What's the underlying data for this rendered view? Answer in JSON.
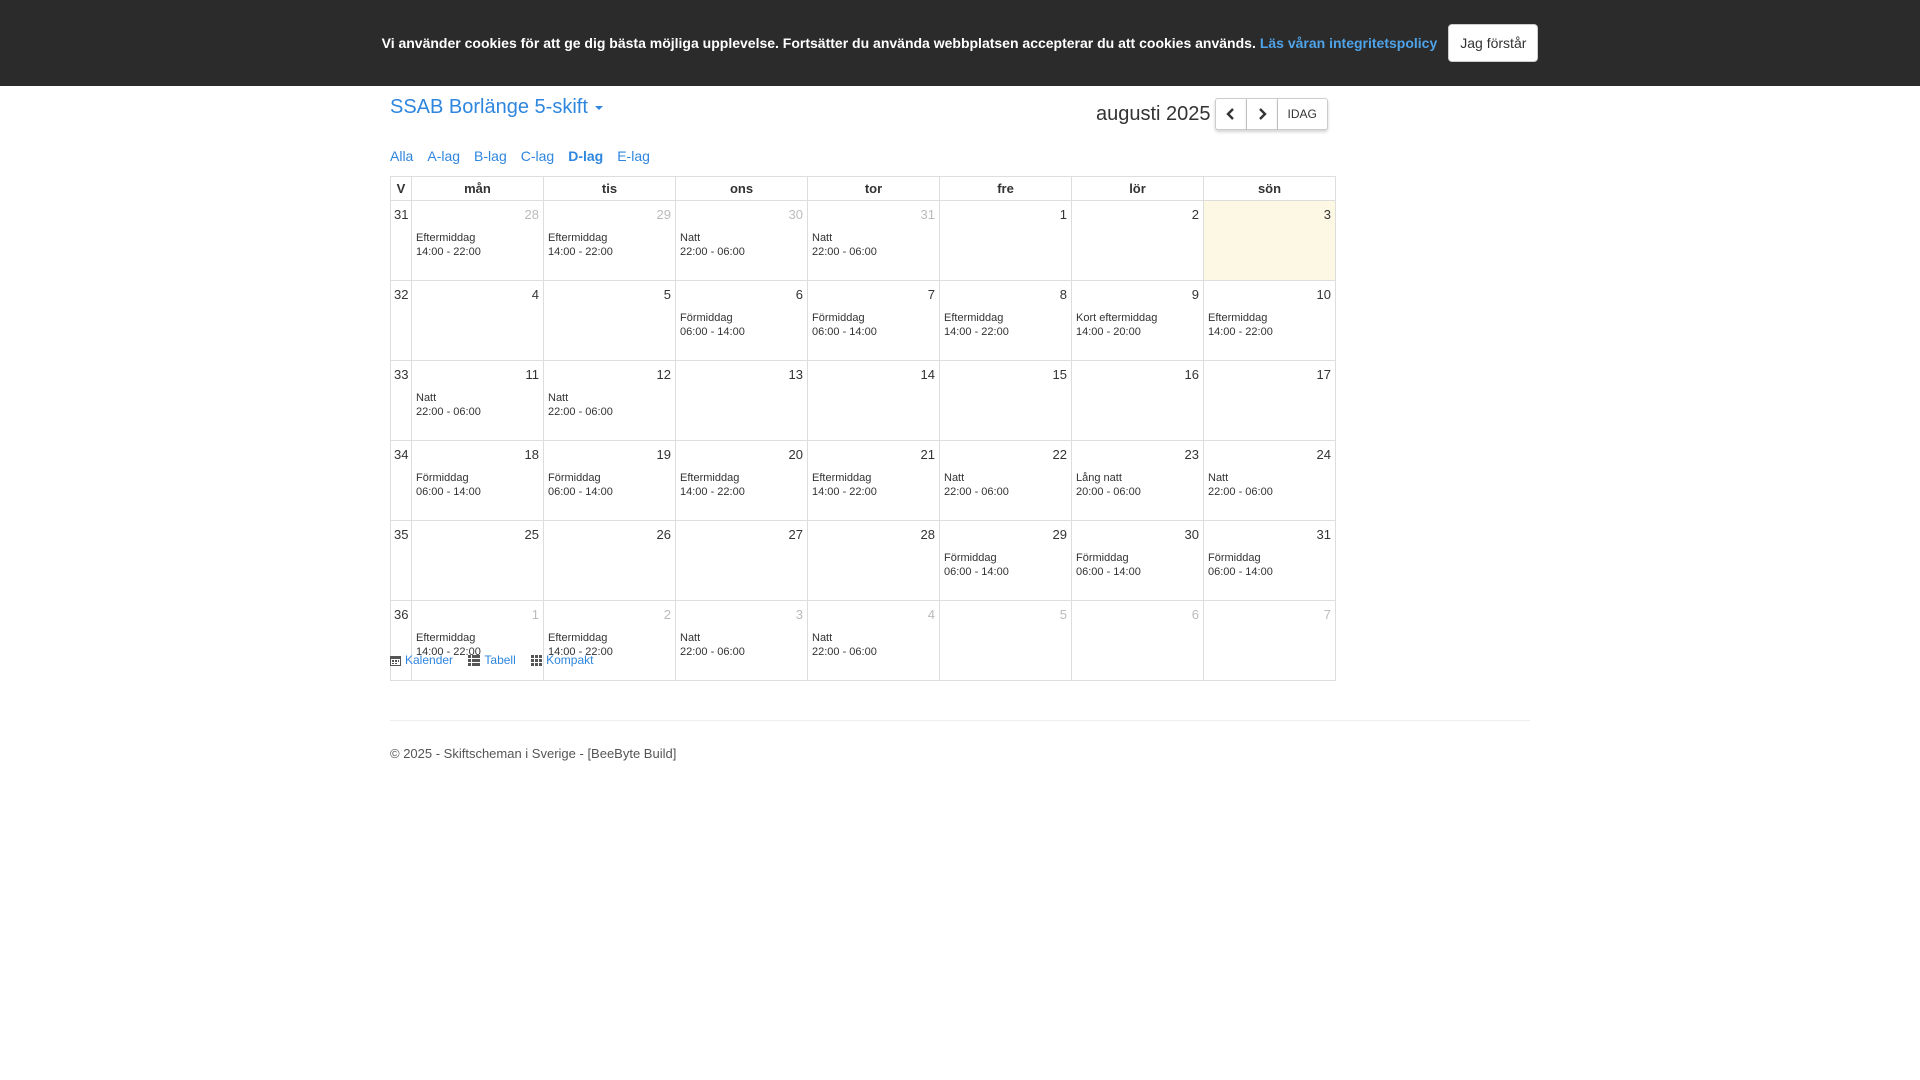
{
  "cookie": {
    "message": "Vi använder cookies för att ge dig bästa möjliga upplevelse. Fortsätter du använda webbplatsen accepterar du att cookies används.",
    "link": "Läs våran integritetspolicy",
    "button": "Jag förstår"
  },
  "header": {
    "title": "SSAB Borlänge 5-skift",
    "month": "augusti 2025",
    "today_label": "IDAG"
  },
  "teams": [
    "Alla",
    "A-lag",
    "B-lag",
    "C-lag",
    "D-lag",
    "E-lag"
  ],
  "calendar": {
    "week_header": "V",
    "days": [
      "mån",
      "tis",
      "ons",
      "tor",
      "fre",
      "lör",
      "sön"
    ],
    "weeks": [
      {
        "w": "31",
        "cells": [
          {
            "d": "28",
            "o": true,
            "n": "Eftermiddag",
            "t": "14:00 - 22:00"
          },
          {
            "d": "29",
            "o": true,
            "n": "Eftermiddag",
            "t": "14:00 - 22:00"
          },
          {
            "d": "30",
            "o": true,
            "n": "Natt",
            "t": "22:00 - 06:00"
          },
          {
            "d": "31",
            "o": true,
            "n": "Natt",
            "t": "22:00 - 06:00"
          },
          {
            "d": "1",
            "o": false,
            "n": "",
            "t": ""
          },
          {
            "d": "2",
            "o": false,
            "n": "",
            "t": ""
          },
          {
            "d": "3",
            "o": false,
            "n": "",
            "t": "",
            "today": true
          }
        ]
      },
      {
        "w": "32",
        "cells": [
          {
            "d": "4",
            "o": false,
            "n": "",
            "t": ""
          },
          {
            "d": "5",
            "o": false,
            "n": "",
            "t": ""
          },
          {
            "d": "6",
            "o": false,
            "n": "Förmiddag",
            "t": "06:00 - 14:00"
          },
          {
            "d": "7",
            "o": false,
            "n": "Förmiddag",
            "t": "06:00 - 14:00"
          },
          {
            "d": "8",
            "o": false,
            "n": "Eftermiddag",
            "t": "14:00 - 22:00"
          },
          {
            "d": "9",
            "o": false,
            "n": "Kort eftermiddag",
            "t": "14:00 - 20:00"
          },
          {
            "d": "10",
            "o": false,
            "n": "Eftermiddag",
            "t": "14:00 - 22:00"
          }
        ]
      },
      {
        "w": "33",
        "cells": [
          {
            "d": "11",
            "o": false,
            "n": "Natt",
            "t": "22:00 - 06:00"
          },
          {
            "d": "12",
            "o": false,
            "n": "Natt",
            "t": "22:00 - 06:00"
          },
          {
            "d": "13",
            "o": false,
            "n": "",
            "t": ""
          },
          {
            "d": "14",
            "o": false,
            "n": "",
            "t": ""
          },
          {
            "d": "15",
            "o": false,
            "n": "",
            "t": ""
          },
          {
            "d": "16",
            "o": false,
            "n": "",
            "t": ""
          },
          {
            "d": "17",
            "o": false,
            "n": "",
            "t": ""
          }
        ]
      },
      {
        "w": "34",
        "cells": [
          {
            "d": "18",
            "o": false,
            "n": "Förmiddag",
            "t": "06:00 - 14:00"
          },
          {
            "d": "19",
            "o": false,
            "n": "Förmiddag",
            "t": "06:00 - 14:00"
          },
          {
            "d": "20",
            "o": false,
            "n": "Eftermiddag",
            "t": "14:00 - 22:00"
          },
          {
            "d": "21",
            "o": false,
            "n": "Eftermiddag",
            "t": "14:00 - 22:00"
          },
          {
            "d": "22",
            "o": false,
            "n": "Natt",
            "t": "22:00 - 06:00"
          },
          {
            "d": "23",
            "o": false,
            "n": "Lång natt",
            "t": "20:00 - 06:00"
          },
          {
            "d": "24",
            "o": false,
            "n": "Natt",
            "t": "22:00 - 06:00"
          }
        ]
      },
      {
        "w": "35",
        "cells": [
          {
            "d": "25",
            "o": false,
            "n": "",
            "t": ""
          },
          {
            "d": "26",
            "o": false,
            "n": "",
            "t": ""
          },
          {
            "d": "27",
            "o": false,
            "n": "",
            "t": ""
          },
          {
            "d": "28",
            "o": false,
            "n": "",
            "t": ""
          },
          {
            "d": "29",
            "o": false,
            "n": "Förmiddag",
            "t": "06:00 - 14:00"
          },
          {
            "d": "30",
            "o": false,
            "n": "Förmiddag",
            "t": "06:00 - 14:00"
          },
          {
            "d": "31",
            "o": false,
            "n": "Förmiddag",
            "t": "06:00 - 14:00"
          }
        ]
      },
      {
        "w": "36",
        "cells": [
          {
            "d": "1",
            "o": true,
            "n": "Eftermiddag",
            "t": "14:00 - 22:00"
          },
          {
            "d": "2",
            "o": true,
            "n": "Eftermiddag",
            "t": "14:00 - 22:00"
          },
          {
            "d": "3",
            "o": true,
            "n": "Natt",
            "t": "22:00 - 06:00"
          },
          {
            "d": "4",
            "o": true,
            "n": "Natt",
            "t": "22:00 - 06:00"
          },
          {
            "d": "5",
            "o": true,
            "n": "",
            "t": ""
          },
          {
            "d": "6",
            "o": true,
            "n": "",
            "t": ""
          },
          {
            "d": "7",
            "o": true,
            "n": "",
            "t": ""
          }
        ]
      }
    ]
  },
  "views": {
    "calendar": "Kalender",
    "table": "Tabell",
    "compact": "Kompakt"
  },
  "footer": {
    "copyright": "© 2025 - Skiftscheman i Sverige - [BeeByte Build]"
  },
  "colors": {
    "link": "#2e86de",
    "cookie_bg": "#2b2b2b",
    "today_bg": "#fcf8e3"
  }
}
